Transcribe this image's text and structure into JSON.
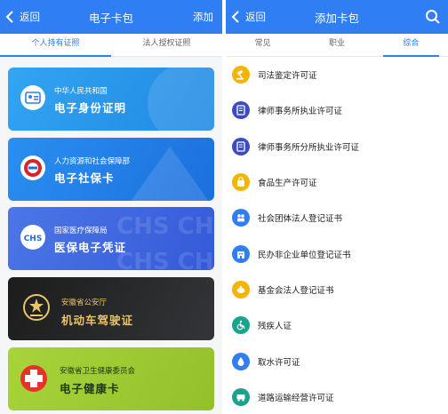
{
  "left": {
    "nav": {
      "back_label": "返回",
      "title": "电子卡包",
      "action_label": "添加"
    },
    "tabs": [
      {
        "label": "个人持有证照",
        "active": true
      },
      {
        "label": "法人授权证照",
        "active": false
      }
    ],
    "cards": [
      {
        "org": "中华人民共和国",
        "name": "电子身份证明",
        "icon": "id-card-icon"
      },
      {
        "org": "人力资源和社会保障部",
        "name": "电子社保卡",
        "icon": "social-security-emblem-icon"
      },
      {
        "org": "国家医疗保障局",
        "name": "医保电子凭证",
        "icon": "chs-logo-icon"
      },
      {
        "org": "安徽省公安厅",
        "name": "机动车驾驶证",
        "icon": "national-emblem-icon"
      },
      {
        "org": "安徽省卫生健康委员会",
        "name": "电子健康卡",
        "icon": "health-cross-icon"
      }
    ]
  },
  "right": {
    "nav": {
      "back_label": "返回",
      "title": "添加卡包",
      "search_icon": "search-icon"
    },
    "tabs": [
      {
        "label": "常见",
        "active": false
      },
      {
        "label": "职业",
        "active": false
      },
      {
        "label": "综合",
        "active": true
      }
    ],
    "items": [
      {
        "label": "司法鉴定许可证",
        "icon": "gavel-icon",
        "color": "#f4b400"
      },
      {
        "label": "律师事务所执业许可证",
        "icon": "lawyer-document-icon",
        "color": "#3b4cc0"
      },
      {
        "label": "律师事务所分所执业许可证",
        "icon": "lawyer-document-icon",
        "color": "#3b4cc0"
      },
      {
        "label": "食品生产许可证",
        "icon": "food-bag-icon",
        "color": "#f4b400"
      },
      {
        "label": "社会团体法人登记证书",
        "icon": "group-people-icon",
        "color": "#2f7ef3"
      },
      {
        "label": "民办非企业单位登记证书",
        "icon": "building-icon",
        "color": "#2f7ef3"
      },
      {
        "label": "基金会法人登记证书",
        "icon": "piggy-bank-icon",
        "color": "#f4b400"
      },
      {
        "label": "残疾人证",
        "icon": "wheelchair-icon",
        "color": "#1aa38c"
      },
      {
        "label": "取水许可证",
        "icon": "water-drop-icon",
        "color": "#2f7ef3"
      },
      {
        "label": "道路运输经营许可证",
        "icon": "vehicle-icon",
        "color": "#1aa38c"
      }
    ]
  },
  "colors": {
    "accent": "#2f7ef3",
    "nav_bg": "#2f7ef3"
  }
}
